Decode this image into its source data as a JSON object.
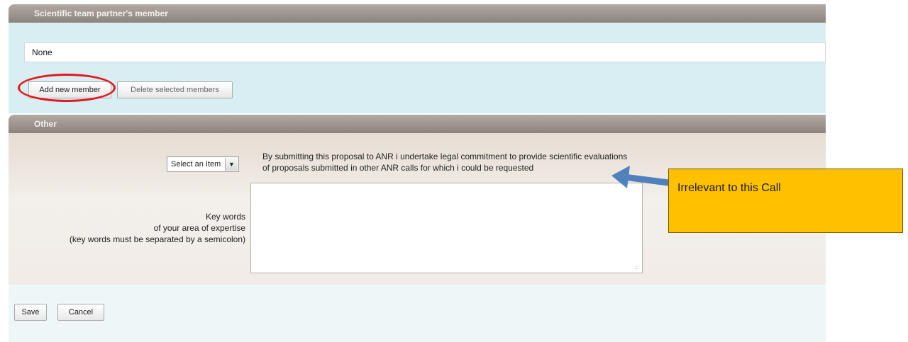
{
  "members_section": {
    "title": "Scientific team partner's member",
    "list_value": "None",
    "add_button": "Add new member",
    "delete_button": "Delete selected members"
  },
  "other_section": {
    "title": "Other",
    "select": {
      "selected": "Select an Item",
      "arrow": "▼"
    },
    "commitment_line1": "By submitting this proposal to ANR i undertake legal commitment to provide scientific evaluations",
    "commitment_line2": "of proposals submitted in other ANR calls for which i could be requested",
    "keywords_label": {
      "line1": "Key words",
      "line2": "of your area of expertise",
      "line3": "(key words must be separated by a semicolon)"
    },
    "keywords_value": ""
  },
  "actions": {
    "save": "Save",
    "cancel": "Cancel"
  },
  "annotation": {
    "note": "Irrelevant to this Call",
    "note_color": "#ffc000",
    "arrow_color": "#4f81bd",
    "highlight_color": "#e0191f"
  }
}
